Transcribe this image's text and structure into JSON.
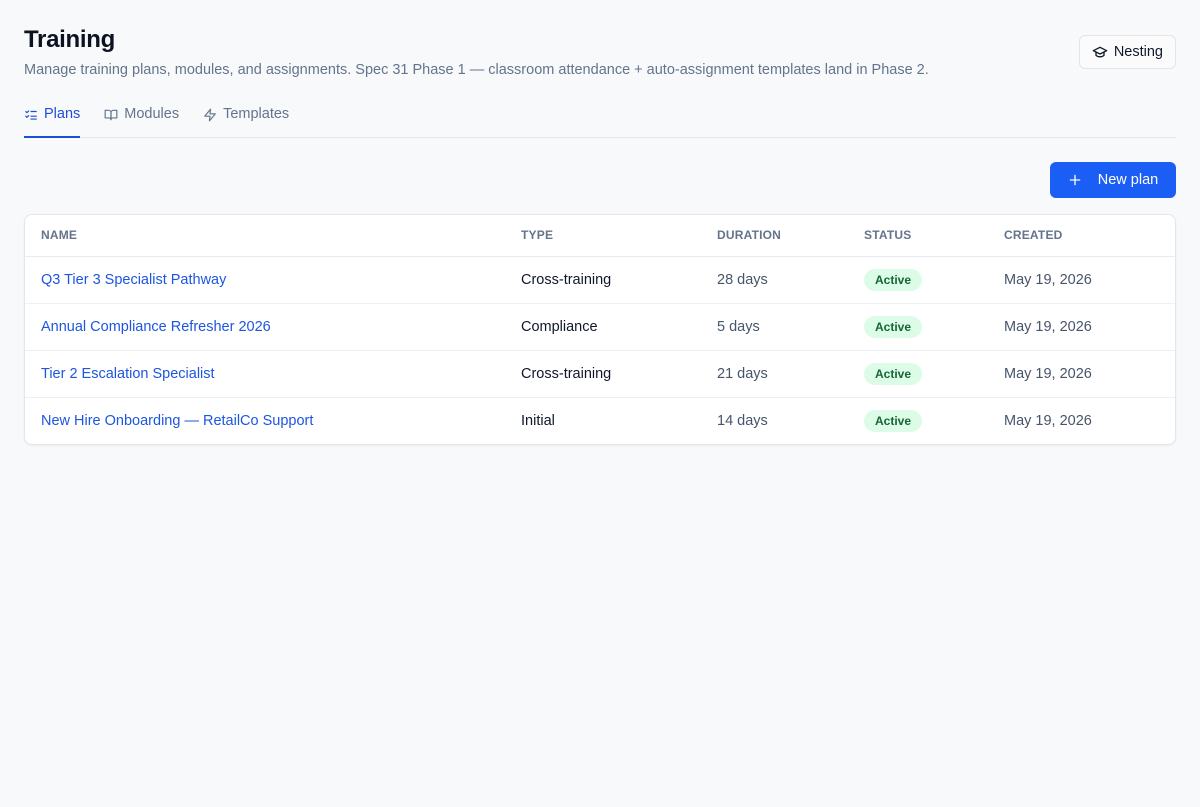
{
  "header": {
    "title": "Training",
    "subtitle": "Manage training plans, modules, and assignments. Spec 31 Phase 1 — classroom attendance + auto-assignment templates land in Phase 2.",
    "nesting_label": "Nesting",
    "nesting_icon": "graduation-cap-icon"
  },
  "tabs": [
    {
      "label": "Plans",
      "icon": "list-checks-icon",
      "active": true
    },
    {
      "label": "Modules",
      "icon": "book-open-icon",
      "active": false
    },
    {
      "label": "Templates",
      "icon": "zap-icon",
      "active": false
    }
  ],
  "toolbar": {
    "new_plan_label": "New plan",
    "new_plan_icon": "plus-icon"
  },
  "table": {
    "columns": [
      "NAME",
      "TYPE",
      "DURATION",
      "STATUS",
      "CREATED"
    ],
    "rows": [
      {
        "name": "Q3 Tier 3 Specialist Pathway",
        "type": "Cross-training",
        "duration": "28 days",
        "status": "Active",
        "created": "May 19, 2026"
      },
      {
        "name": "Annual Compliance Refresher 2026",
        "type": "Compliance",
        "duration": "5 days",
        "status": "Active",
        "created": "May 19, 2026"
      },
      {
        "name": "Tier 2 Escalation Specialist",
        "type": "Cross-training",
        "duration": "21 days",
        "status": "Active",
        "created": "May 19, 2026"
      },
      {
        "name": "New Hire Onboarding — RetailCo Support",
        "type": "Initial",
        "duration": "14 days",
        "status": "Active",
        "created": "May 19, 2026"
      }
    ]
  },
  "colors": {
    "accent": "#1a5ef5",
    "link": "#1d56e0",
    "status_active_bg": "#dcfce7",
    "status_active_text": "#166534",
    "background": "#f8f9fb"
  }
}
